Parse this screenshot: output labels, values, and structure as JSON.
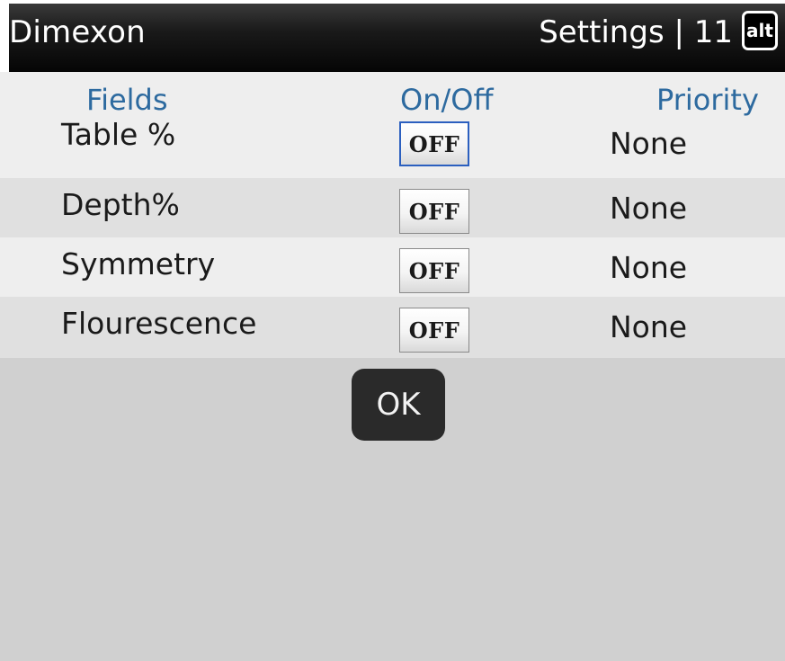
{
  "titlebar": {
    "app_name": "Dimexon",
    "screen_title": "Settings | 11",
    "alt_indicator": "alt"
  },
  "table": {
    "headers": {
      "fields": "Fields",
      "onoff": "On/Off",
      "priority": "Priority"
    },
    "rows": [
      {
        "field": "Table %",
        "toggle": "OFF",
        "priority": "None",
        "focused": true
      },
      {
        "field": "Depth%",
        "toggle": "OFF",
        "priority": "None",
        "focused": false
      },
      {
        "field": "Symmetry",
        "toggle": "OFF",
        "priority": "None",
        "focused": false
      },
      {
        "field": "Flourescence",
        "toggle": "OFF",
        "priority": "None",
        "focused": false
      }
    ]
  },
  "actions": {
    "ok_label": "OK"
  },
  "colors": {
    "header_text": "#2d6a9f",
    "focus_border": "#2b5fbf",
    "background": "#d0d0d0",
    "titlebar": "#0a0a0a"
  }
}
